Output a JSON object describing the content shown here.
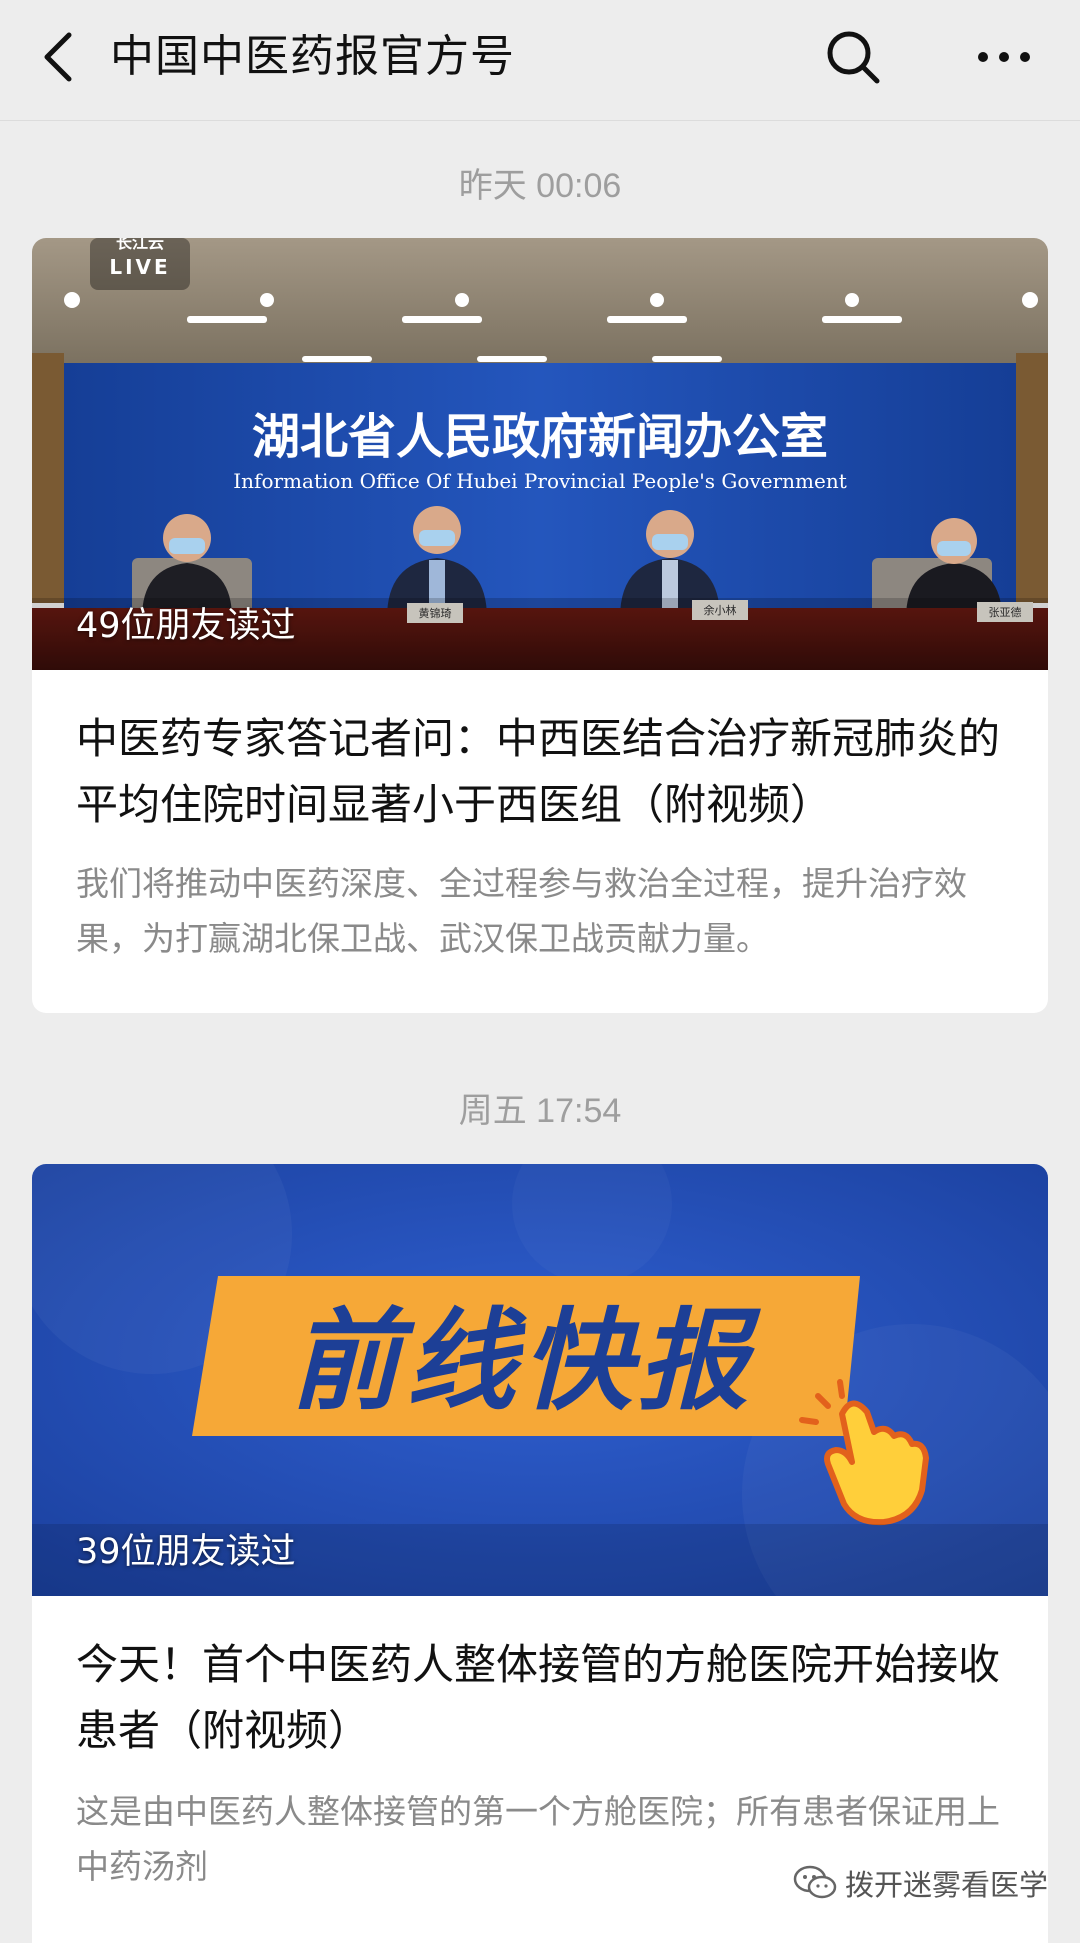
{
  "header": {
    "title": "中国中医药报官方号",
    "back_icon": "chevron-left-icon",
    "search_icon": "search-icon",
    "more_icon": "more-horizontal-icon"
  },
  "feed": [
    {
      "timestamp": "昨天 00:06",
      "cover": {
        "live_badge": "LIVE",
        "live_badge_top": "长江云",
        "backdrop_title": "湖北省人民政府新闻办公室",
        "backdrop_subtitle": "Information Office Of Hubei Provincial People's Government",
        "nameplates": [
          "黄锦琦",
          "余小林",
          "张亚德"
        ]
      },
      "read_count": "49位朋友读过",
      "title": "中医药专家答记者问：中西医结合治疗新冠肺炎的平均住院时间显著小于西医组（附视频）",
      "summary": "我们将推动中医药深度、全过程参与救治全过程，提升治疗效果，为打赢湖北保卫战、武汉保卫战贡献力量。"
    },
    {
      "timestamp": "周五 17:54",
      "cover": {
        "banner_text": "前线快报"
      },
      "read_count": "39位朋友读过",
      "title": "今天！首个中医药人整体接管的方舱医院开始接收患者（附视频）",
      "summary": "这是由中医药人整体接管的第一个方舱医院；所有患者保证用上中药汤剂"
    }
  ],
  "watermark": {
    "text": "拨开迷雾看医学",
    "icon": "wechat-icon"
  },
  "colors": {
    "page_bg": "#ededed",
    "card_bg": "#ffffff",
    "backdrop_blue": "#1f4fb0",
    "banner_orange": "#f6a837",
    "banner_text_blue": "#1d3f96",
    "timestamp_gray": "#9e9e9e"
  }
}
